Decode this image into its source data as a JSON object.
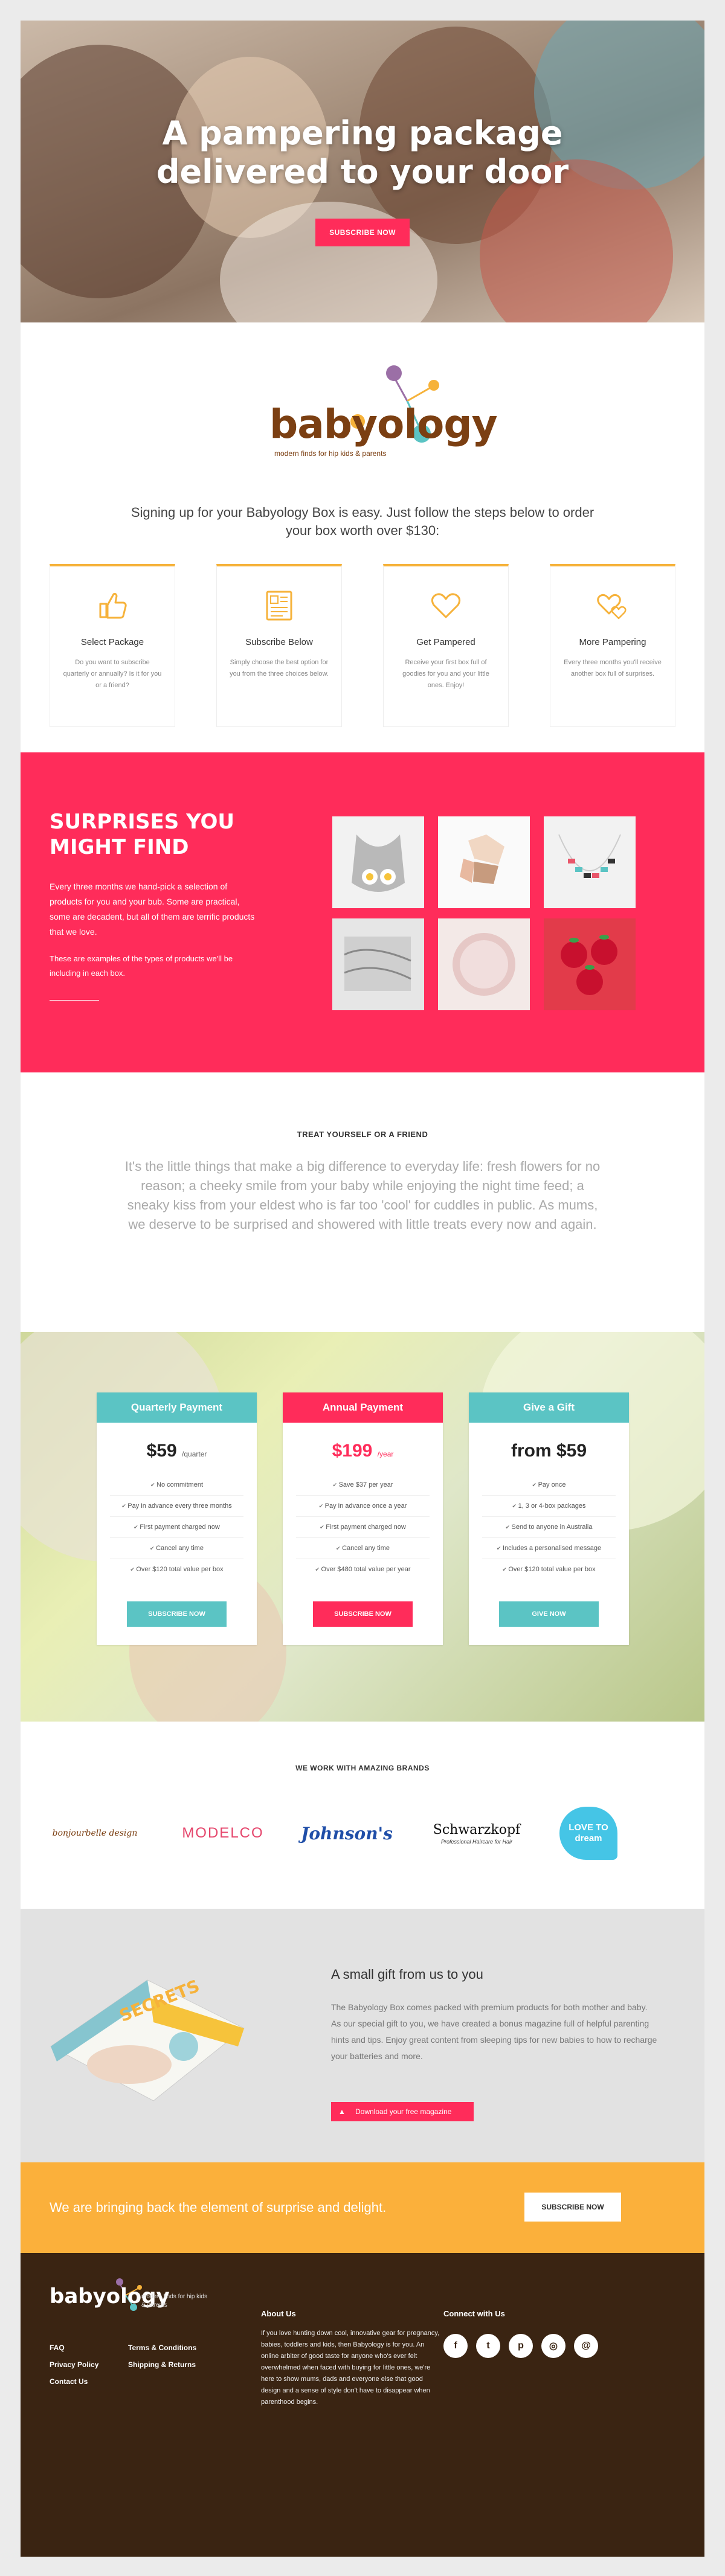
{
  "hero": {
    "title_line1": "A pampering package",
    "title_line2": "delivered to your door",
    "cta": "SUBSCRIBE NOW"
  },
  "brand": {
    "logo_text": "babyology",
    "tagline": "modern finds for hip kids & parents",
    "colors": {
      "pink": "#ff2c5a",
      "orange": "#fbb03b",
      "teal": "#5bc4c4",
      "brown": "#3a2412"
    }
  },
  "intro": {
    "lead": "Signing up for your Babyology Box is easy. Just follow the steps below to order your box worth over $130:",
    "steps": [
      {
        "icon": "thumbs-up-icon",
        "title": "Select Package",
        "text": "Do you want to subscribe quarterly or annually? Is it for you or a friend?"
      },
      {
        "icon": "newspaper-icon",
        "title": "Subscribe Below",
        "text": "Simply choose the best option for you from the three choices below."
      },
      {
        "icon": "heart-icon",
        "title": "Get Pampered",
        "text": "Receive your first box full of goodies for you and your little ones. Enjoy!"
      },
      {
        "icon": "hearts-icon",
        "title": "More Pampering",
        "text": "Every three months you'll receive another box full of surprises."
      }
    ]
  },
  "surprises": {
    "title_line1": "SURPRISES YOU",
    "title_line2": "MIGHT FIND",
    "text1": "Every three months we hand-pick a selection of products for you and your bub. Some are practical, some are decadent, but all of them are terrific products that we love.",
    "text2": "These are examples of the types of products we'll be including in each box."
  },
  "quote": {
    "heading": "TREAT YOURSELF OR A FRIEND",
    "text": "It's the little things that make a big difference to everyday life: fresh flowers for no reason; a cheeky smile from your baby while enjoying the night time feed; a sneaky kiss from your eldest who is far too 'cool' for cuddles in public. As mums, we deserve to be surprised and showered with little treats every now and again."
  },
  "pricing": [
    {
      "name": "Quarterly Payment",
      "price": "$59",
      "unit": "/quarter",
      "color": "#5bc4c4",
      "features": [
        "No commitment",
        "Pay in advance every three months",
        "First payment charged now",
        "Cancel any time",
        "Over $120 total value per box"
      ],
      "button": "SUBSCRIBE NOW"
    },
    {
      "name": "Annual Payment",
      "price": "$199",
      "unit": "/year",
      "color": "#ff2c5a",
      "features": [
        "Save $37 per year",
        "Pay in advance once a year",
        "First payment charged now",
        "Cancel any time",
        "Over $480 total value per year"
      ],
      "button": "SUBSCRIBE NOW"
    },
    {
      "name": "Give a Gift",
      "price": "from $59",
      "unit": "",
      "color": "#5bc4c4",
      "features": [
        "Pay once",
        "1, 3 or 4-box packages",
        "Send to anyone in Australia",
        "Includes a personalised message",
        "Over $120 total value per box"
      ],
      "button": "GIVE NOW"
    }
  ],
  "brands": {
    "heading": "WE WORK WITH AMAZING BRANDS",
    "items": [
      {
        "name": "Bonjour Belle Design",
        "label": "bonjourbelle design"
      },
      {
        "name": "ModelCo",
        "label": "MODELCO"
      },
      {
        "name": "Johnson's",
        "label": "Johnson's"
      },
      {
        "name": "Schwarzkopf",
        "label": "Schwarzkopf",
        "sub": "Professional Haircare for Hair"
      },
      {
        "name": "Love To Dream",
        "label": "LOVE TO dream"
      }
    ]
  },
  "gift": {
    "magazine_cover": "SECRETS",
    "title": "A small gift from us to you",
    "text": "The Babyology Box comes packed with premium products for both mother and baby. As our special gift to you, we have created a bonus magazine full of helpful parenting hints and tips. Enjoy great content from sleeping tips for new babies to how to recharge your batteries and more.",
    "button": "Download your free magazine"
  },
  "cta_bar": {
    "text": "We are bringing back the element of surprise and delight.",
    "button": "SUBSCRIBE NOW"
  },
  "footer": {
    "logo": "babyology",
    "tagline": "modern finds for hip kids & parents",
    "links": [
      "FAQ",
      "Terms & Conditions",
      "Privacy Policy",
      "Shipping & Returns",
      "Contact Us"
    ],
    "about_title": "About Us",
    "about_text": "If you love hunting down cool, innovative gear for pregnancy, babies, toddlers and kids, then Babyology is for you. An online arbiter of good taste for anyone who's ever felt overwhelmed when faced with buying for little ones, we're here to show mums, dads and everyone else that good design and a sense of style don't have to disappear when parenthood begins.",
    "connect_title": "Connect with Us",
    "socials": [
      {
        "name": "facebook",
        "glyph": "f"
      },
      {
        "name": "twitter",
        "glyph": "t"
      },
      {
        "name": "pinterest",
        "glyph": "p"
      },
      {
        "name": "instagram",
        "glyph": "◎"
      },
      {
        "name": "email",
        "glyph": "@"
      }
    ]
  }
}
